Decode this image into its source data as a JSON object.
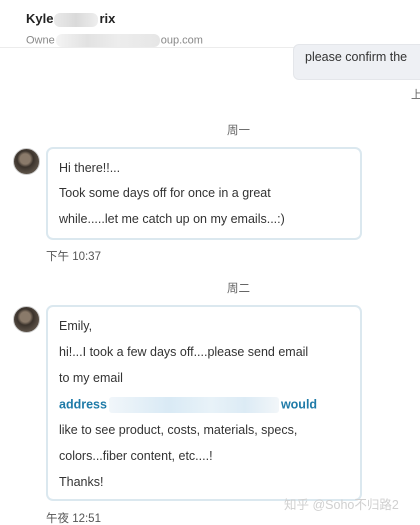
{
  "header": {
    "name_start": "Kyle",
    "name_end": "rix",
    "sub_start": "Owne",
    "sub_end": "oup.com"
  },
  "outgoing": {
    "text": "please confirm the",
    "meta": "上"
  },
  "messages": [
    {
      "day": "周一",
      "lines": [
        "Hi there!!...",
        "Took some days off for once in a great",
        "while.....let me catch up on my emails...:)"
      ],
      "time": "下午 10:37"
    },
    {
      "day": "周二",
      "lines": [
        "Emily,",
        "hi!...I took a few days off....please send email",
        "to my email"
      ],
      "link_start": "address",
      "link_end": "would",
      "lines_after": [
        "like to see product, costs, materials, specs,",
        "colors...fiber content, etc....!",
        "Thanks!"
      ],
      "time": "午夜 12:51"
    }
  ],
  "watermark": "知乎 @Soho不归路2"
}
